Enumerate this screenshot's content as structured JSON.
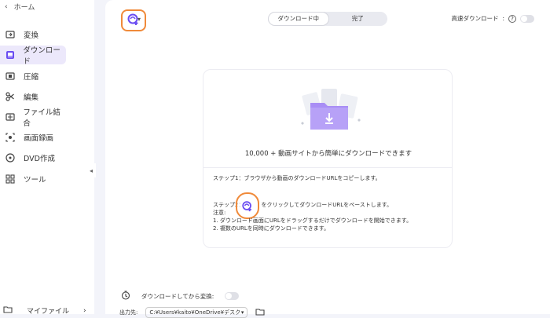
{
  "sidebar": {
    "home_label": "ホーム",
    "items": [
      {
        "label": "変換",
        "icon": "convert-icon"
      },
      {
        "label": "ダウンロード",
        "icon": "download-icon",
        "active": true
      },
      {
        "label": "圧縮",
        "icon": "compress-icon"
      },
      {
        "label": "編集",
        "icon": "scissors-icon"
      },
      {
        "label": "ファイル結合",
        "icon": "merge-icon"
      },
      {
        "label": "画面録画",
        "icon": "screen-record-icon"
      },
      {
        "label": "DVD作成",
        "icon": "dvd-icon"
      },
      {
        "label": "ツール",
        "icon": "tools-icon"
      }
    ],
    "bottom_label": "マイファイル"
  },
  "toolbar": {
    "add_icon": "add-url-icon",
    "tabs": [
      {
        "label": "ダウンロード中",
        "active": true
      },
      {
        "label": "完了",
        "active": false
      }
    ],
    "fast_download_label": "高速ダウンロード",
    "fast_download_on": false
  },
  "panel": {
    "headline": "10,000 + 動画サイトから簡単にダウンロードできます",
    "step1": "ステップ1：ブラウザから動画のダウンロードURLをコピーします。",
    "step2_prefix": "ステップ2：",
    "step2_suffix": "をクリックしてダウンロードURLをペーストします。",
    "note_title": "注意:",
    "note1": "1. ダウンロード画面にURLをドラッグするだけでダウンロードを開始できます。",
    "note2": "2. 複数のURLを同時にダウンロードできます。"
  },
  "bottom": {
    "convert_after_label": "ダウンロードしてから変換:",
    "convert_after_on": false,
    "output_label": "出力先:",
    "output_path": "C:¥Users¥kaito¥OneDrive¥デスク"
  },
  "colors": {
    "accent": "#6a4cf2",
    "highlight": "#f08a3a"
  }
}
